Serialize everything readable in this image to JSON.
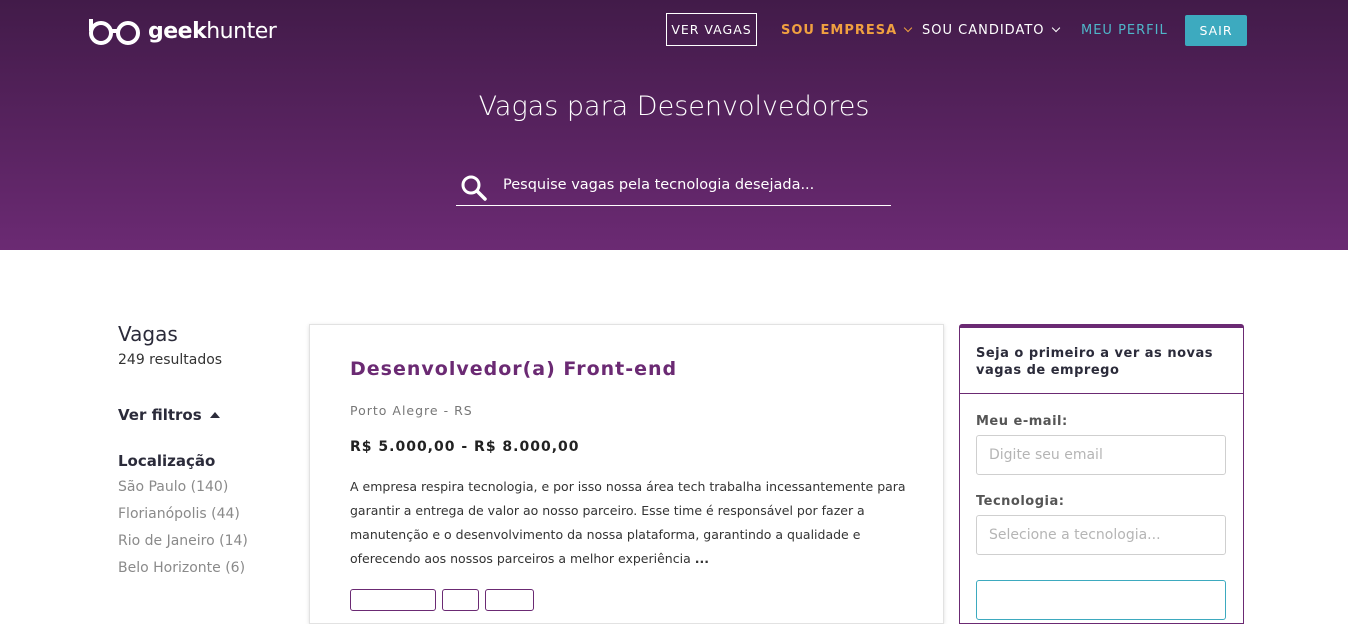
{
  "header": {
    "brand": {
      "prefix": "geek",
      "suffix": "hunter"
    },
    "nav": {
      "ver_vagas": "VER VAGAS",
      "sou_empresa": "SOU EMPRESA",
      "sou_candidato": "SOU CANDIDATO",
      "meu_perfil": "MEU PERFIL",
      "sair": "SAIR"
    },
    "title": "Vagas para Desenvolvedores",
    "search": {
      "placeholder": "Pesquise vagas pela tecnologia desejada..."
    }
  },
  "sidebar": {
    "title": "Vagas",
    "count": "249 resultados",
    "filters_label": "Ver filtros",
    "location_title": "Localização",
    "locations": [
      "São Paulo (140)",
      "Florianópolis (44)",
      "Rio de Janeiro (14)",
      "Belo Horizonte (6)"
    ]
  },
  "job": {
    "title": "Desenvolvedor(a) Front-end",
    "location": "Porto Alegre - RS",
    "salary": "R$ 5.000,00 - R$ 8.000,00",
    "description": "A empresa respira tecnologia, e por isso nossa área tech trabalha incessantemente para garantir a entrega de valor ao nosso parceiro. Esse time é responsável por fazer a manutenção e o desenvolvimento da nossa plataforma, garantindo a qualidade e oferecendo aos nossos parceiros a melhor experiência",
    "more": "..."
  },
  "signup": {
    "heading": "Seja o primeiro a ver as novas vagas de emprego",
    "email_label": "Meu e-mail:",
    "email_placeholder": "Digite seu email",
    "tech_label": "Tecnologia:",
    "tech_placeholder": "Selecione a tecnologia..."
  },
  "colors": {
    "hero_top": "#421b49",
    "hero_bottom": "#6b2a73",
    "accent_orange": "#f0a040",
    "accent_teal": "#3daabf",
    "job_title_purple": "#6b2a73"
  },
  "icons": [
    "logo-glasses-icon",
    "chevron-down-icon",
    "search-icon",
    "caret-up-icon"
  ]
}
